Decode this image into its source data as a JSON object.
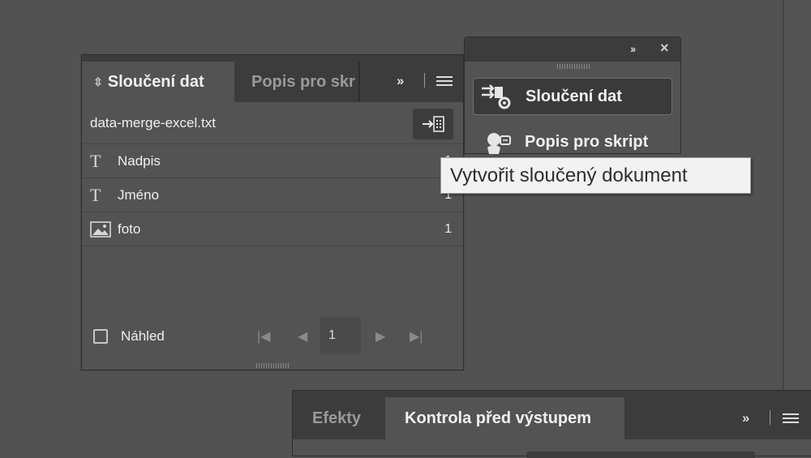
{
  "data_merge_panel": {
    "tab_active": "Sloučení dat",
    "tab_inactive": "Popis pro skr",
    "more_glyph": "››",
    "source_file": "data-merge-excel.txt",
    "fields": [
      {
        "name": "Nadpis",
        "type": "text",
        "count": "1"
      },
      {
        "name": "Jméno",
        "type": "text",
        "count": "1"
      },
      {
        "name": "foto",
        "type": "image",
        "count": "1"
      }
    ],
    "preview_label": "Náhled",
    "page_number": "1"
  },
  "scripts_panel": {
    "items": [
      {
        "label": "Sloučení dat",
        "icon": "data-merge-icon",
        "selected": true
      },
      {
        "label": "Popis pro skript",
        "icon": "script-label-icon",
        "selected": false
      }
    ]
  },
  "tooltip": {
    "text": "Vytvořit sloučený dokument"
  },
  "bottom_panel": {
    "tabs": [
      {
        "label": "Efekty",
        "active": false
      },
      {
        "label": "Kontrola před výstupem",
        "active": true
      }
    ]
  }
}
